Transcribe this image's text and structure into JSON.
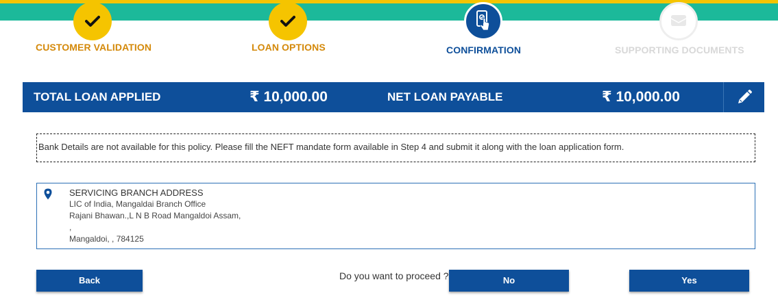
{
  "steps": [
    {
      "label": "CUSTOMER VALIDATION",
      "state": "done",
      "icon": "checkmark-icon",
      "color": "#d4890a"
    },
    {
      "label": "LOAN OPTIONS",
      "state": "done",
      "icon": "checkmark-icon",
      "color": "#d4890a"
    },
    {
      "label": "CONFIRMATION",
      "state": "active",
      "icon": "phone-touch-icon",
      "color": "#0e4f9a"
    },
    {
      "label": "SUPPORTING DOCUMENTS",
      "state": "pending",
      "icon": "document-icon",
      "color": "#d8d8d8"
    }
  ],
  "summary": {
    "total_label": "TOTAL LOAN APPLIED",
    "total_amount": "₹ 10,000.00",
    "net_label": "NET LOAN PAYABLE",
    "net_amount": "₹ 10,000.00",
    "edit_icon": "pencil-icon"
  },
  "notice": "Bank Details are not available for this policy. Please fill the NEFT mandate form available in Step 4 and submit it along with the loan application form.",
  "address": {
    "icon": "location-pin-icon",
    "heading": "SERVICING BRANCH ADDRESS",
    "lines": [
      "LIC of India, Mangaldai Branch Office",
      "Rajani Bhawan.,L N B Road Mangaldoi Assam,",
      ",",
      "Mangaldoi, , 784125"
    ]
  },
  "actions": {
    "back_label": "Back",
    "prompt": "Do you want to proceed ?",
    "no_label": "No",
    "yes_label": "Yes"
  },
  "colors": {
    "primary": "#0e4f9a",
    "accent_yellow": "#f5c400",
    "accent_teal": "#1cb99a"
  }
}
